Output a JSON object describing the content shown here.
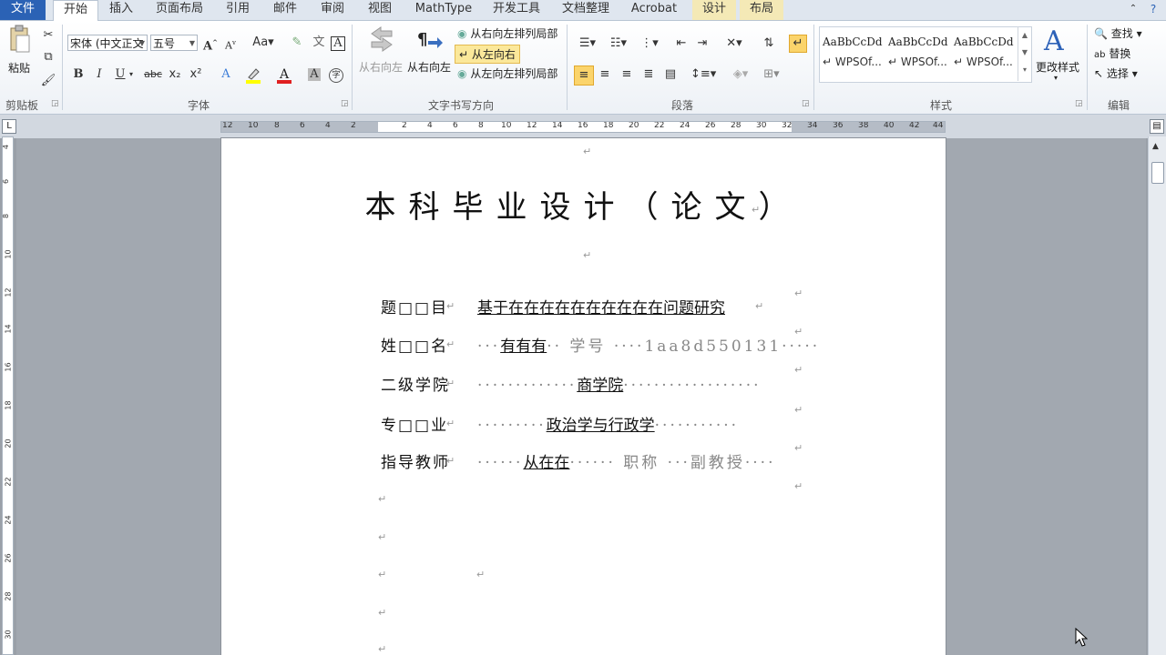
{
  "tabs": [
    "文件",
    "开始",
    "插入",
    "页面布局",
    "引用",
    "邮件",
    "审阅",
    "视图",
    "MathType",
    "开发工具",
    "文档整理",
    "Acrobat",
    "设计",
    "布局"
  ],
  "clipboard": {
    "paste": "粘贴",
    "group": "剪贴板"
  },
  "font": {
    "name": "宋体 (中文正文",
    "size": "五号",
    "group": "字体",
    "bold": "B",
    "italic": "I",
    "underline": "U",
    "strike": "abc",
    "sub": "x₂",
    "sup": "x²",
    "grow": "A",
    "shrink": "A",
    "case": "Aa"
  },
  "direction": {
    "rtl_label": "从右向左",
    "ltr_label": "从右向左",
    "rtl_part": "从右向左排列局部",
    "ltr": "从左向右",
    "ltr_part": "从左向左排列局部",
    "group": "文字书写方向"
  },
  "paragraph": {
    "group": "段落"
  },
  "styles": {
    "items": [
      {
        "sample": "AaBbCcDd",
        "name": "↵ WPSOf..."
      },
      {
        "sample": "AaBbCcDd",
        "name": "↵ WPSOf..."
      },
      {
        "sample": "AaBbCcDd",
        "name": "↵ WPSOf..."
      }
    ],
    "change": "更改样式",
    "group": "样式"
  },
  "editing": {
    "find": "查找",
    "replace": "替换",
    "select": "选择",
    "group": "编辑"
  },
  "ruler": {
    "h_left": [
      "12",
      "10",
      "8",
      "6",
      "4",
      "2"
    ],
    "h_mid": [
      "2",
      "4",
      "6",
      "8",
      "10",
      "12",
      "14",
      "16",
      "18",
      "20",
      "22",
      "24",
      "26",
      "28",
      "30",
      "32"
    ],
    "h_right": [
      "34",
      "36",
      "38",
      "40",
      "42",
      "44"
    ],
    "v": [
      "4",
      "6",
      "8",
      "10",
      "12",
      "14",
      "16",
      "18",
      "20",
      "22",
      "24",
      "26",
      "28",
      "30"
    ],
    "tab_marker": "L"
  },
  "document": {
    "title": "本科毕业设计（论文）",
    "rows": [
      {
        "label": "题□□目",
        "value_pre": "",
        "value": "基于在在在在在在在在在在问题研究",
        "value_post": ""
      },
      {
        "label": "姓□□名",
        "value_pre": "···",
        "value": "有有有",
        "value_post": "··  学号  ····1aa8d550131·····"
      },
      {
        "label": "二级学院",
        "value_pre": "·············",
        "value": "商学院",
        "value_post": "··················"
      },
      {
        "label": "专□□业",
        "value_pre": "·········",
        "value": "政治学与行政学",
        "value_post": "···········"
      },
      {
        "label": "指导教师",
        "value_pre": "······",
        "value": "从在在",
        "value_post": "······  职称  ···副教授····"
      }
    ],
    "para_mark": "↵",
    "end_mark": "↵"
  }
}
